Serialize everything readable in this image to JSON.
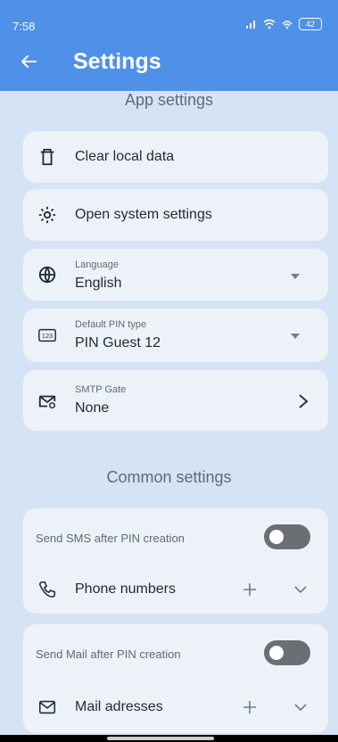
{
  "status": {
    "time": "7:58",
    "battery": "42"
  },
  "appbar": {
    "title": "Settings"
  },
  "sections": {
    "app": "App settings",
    "common": "Common settings"
  },
  "app_settings": {
    "clear": "Clear local data",
    "system": "Open system settings",
    "language_label": "Language",
    "language_value": "English",
    "pin_label": "Default PIN type",
    "pin_value": "PIN Guest 12",
    "smtp_label": "SMTP Gate",
    "smtp_value": "None"
  },
  "common_settings": {
    "sms_toggle_label": "Send SMS after PIN creation",
    "sms_toggle_on": false,
    "phone_label": "Phone numbers",
    "mail_toggle_label": "Send Mail after PIN creation",
    "mail_toggle_on": false,
    "mail_label": "Mail adresses"
  },
  "icons": {
    "back": "arrow-left-icon",
    "clear": "trash-icon",
    "system": "gear-icon",
    "language": "globe-icon",
    "pin": "pin-123-icon",
    "smtp": "mail-gear-icon",
    "phone": "phone-icon",
    "mail": "mail-icon"
  },
  "colors": {
    "appbar": "#4f90e8",
    "background": "#d6e3f4",
    "card": "#edf2f8"
  }
}
